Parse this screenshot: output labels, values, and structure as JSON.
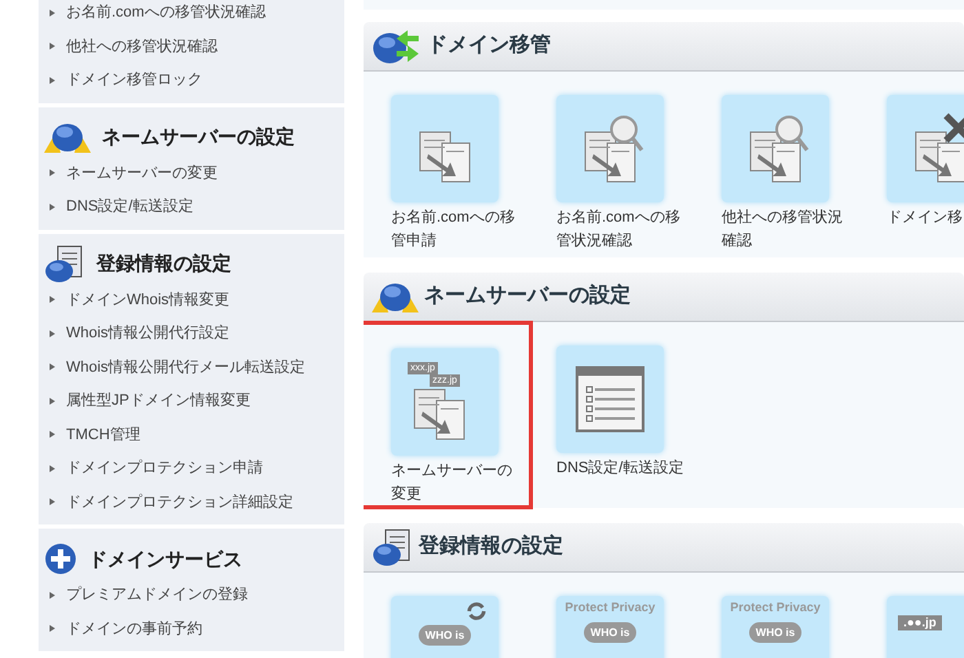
{
  "sidebar": {
    "sections": [
      {
        "items": [
          "お名前.comへの移管状況確認",
          "他社への移管状況確認",
          "ドメイン移管ロック"
        ]
      },
      {
        "title": "ネームサーバーの設定",
        "items": [
          "ネームサーバーの変更",
          "DNS設定/転送設定"
        ]
      },
      {
        "title": "登録情報の設定",
        "items": [
          "ドメインWhois情報変更",
          "Whois情報公開代行設定",
          "Whois情報公開代行メール転送設定",
          "属性型JPドメイン情報変更",
          "TMCH管理",
          "ドメインプロテクション申請",
          "ドメインプロテクション詳細設定"
        ]
      },
      {
        "title": "ドメインサービス",
        "items": [
          "プレミアムドメインの登録",
          "ドメインの事前予約"
        ]
      }
    ]
  },
  "main": {
    "sections": [
      {
        "title": "ドメイン移管",
        "tiles": [
          {
            "label": "お名前.comへの移管申請",
            "highlighted": false
          },
          {
            "label": "お名前.comへの移管状況確認",
            "highlighted": false
          },
          {
            "label": "他社への移管状況確認",
            "highlighted": false
          },
          {
            "label": "ドメイン移",
            "highlighted": false
          }
        ]
      },
      {
        "title": "ネームサーバーの設定",
        "tiles": [
          {
            "label": "ネームサーバーの変更",
            "icon_texts": [
              "xxx.jp",
              "zzz.jp"
            ],
            "highlighted": true
          },
          {
            "label": "DNS設定/転送設定",
            "highlighted": false
          }
        ]
      },
      {
        "title": "登録情報の設定",
        "tiles": [
          {
            "icon_texts": [
              "WHO is"
            ],
            "highlighted": false
          },
          {
            "icon_texts": [
              "Protect Privacy",
              "WHO is"
            ],
            "highlighted": false
          },
          {
            "icon_texts": [
              "Protect Privacy",
              "WHO is"
            ],
            "highlighted": false
          },
          {
            "icon_texts": [
              ".●●.jp"
            ],
            "highlighted": false
          }
        ]
      }
    ]
  }
}
